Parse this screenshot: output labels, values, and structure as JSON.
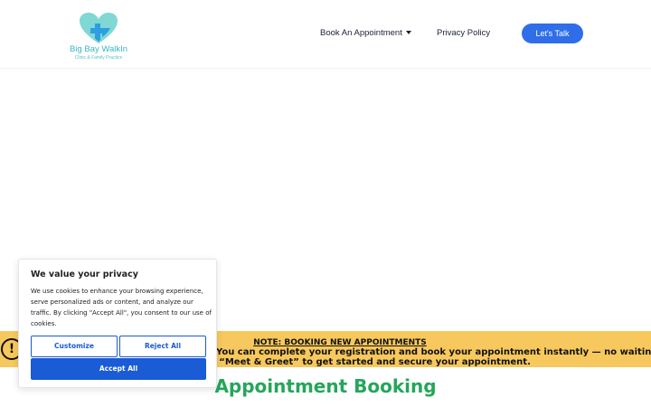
{
  "header": {
    "logo": {
      "title": "Big Bay WalkIn",
      "subtitle": "Clinic & Family Practice",
      "icon": "heart-cross-icon",
      "colors": {
        "heart_light": "#7fd8d3",
        "heart_dark": "#2d9ee0",
        "text": "#3bb5c4"
      }
    },
    "nav": {
      "book": "Book An Appointment",
      "book_icon": "caret-down-icon",
      "privacy": "Privacy Policy"
    },
    "cta": "Let's Talk",
    "cta_color": "#2f6ee8"
  },
  "note": {
    "icon": "exclamation-circle-icon",
    "title": "NOTE: BOOKING NEW APPOINTMENTS",
    "line1": "You can complete your registration and book your appointment instantly — no waiting time. Please",
    "line2": "t “Meet & Greet” to get started and secure your appointment.",
    "background": "#f7c85d"
  },
  "main": {
    "heading": "Appointment Booking",
    "heading_color": "#25a65a"
  },
  "cookie": {
    "title": "We value your privacy",
    "body": "We use cookies to enhance your browsing experience, serve personalized ads or content, and analyze our traffic. By clicking \"Accept All\", you consent to our use of cookies.",
    "customize": "Customize",
    "reject": "Reject All",
    "accept": "Accept All",
    "accent": "#1a5bd6"
  }
}
